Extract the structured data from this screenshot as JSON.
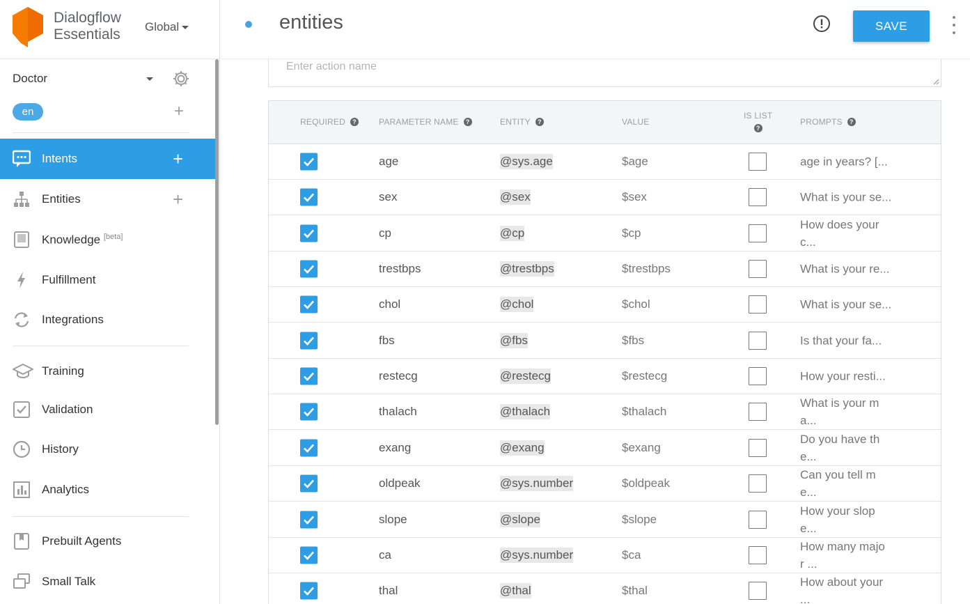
{
  "brand": {
    "line1": "Dialogflow",
    "line2": "Essentials",
    "region": "Global",
    "logo_color": "#f57c00"
  },
  "agent": {
    "name": "Doctor",
    "language": "en"
  },
  "nav": {
    "intents": "Intents",
    "entities": "Entities",
    "knowledge": "Knowledge",
    "knowledge_badge": "[beta]",
    "fulfillment": "Fulfillment",
    "integrations": "Integrations",
    "training": "Training",
    "validation": "Validation",
    "history": "History",
    "analytics": "Analytics",
    "prebuilt": "Prebuilt Agents",
    "smalltalk": "Small Talk"
  },
  "header": {
    "title": "entities",
    "save_label": "SAVE"
  },
  "action": {
    "placeholder": "Enter action name"
  },
  "table": {
    "columns": {
      "required": "REQUIRED",
      "parameter": "PARAMETER NAME",
      "entity": "ENTITY",
      "value": "VALUE",
      "islist": "IS LIST",
      "prompts": "PROMPTS"
    },
    "rows": [
      {
        "required": true,
        "name": "age",
        "entity": "@sys.age",
        "value": "$age",
        "is_list": false,
        "prompt": "age in years? [..."
      },
      {
        "required": true,
        "name": "sex",
        "entity": "@sex",
        "value": "$sex",
        "is_list": false,
        "prompt": "What is your se..."
      },
      {
        "required": true,
        "name": "cp",
        "entity": "@cp",
        "value": "$cp",
        "is_list": false,
        "prompt": "How does your\nc..."
      },
      {
        "required": true,
        "name": "trestbps",
        "entity": "@trestbps",
        "value": "$trestbps",
        "is_list": false,
        "prompt": "What is your re..."
      },
      {
        "required": true,
        "name": "chol",
        "entity": "@chol",
        "value": "$chol",
        "is_list": false,
        "prompt": "What is your se..."
      },
      {
        "required": true,
        "name": "fbs",
        "entity": "@fbs",
        "value": "$fbs",
        "is_list": false,
        "prompt": "Is that your fa..."
      },
      {
        "required": true,
        "name": "restecg",
        "entity": "@restecg",
        "value": "$restecg",
        "is_list": false,
        "prompt": "How your resti..."
      },
      {
        "required": true,
        "name": "thalach",
        "entity": "@thalach",
        "value": "$thalach",
        "is_list": false,
        "prompt": "What is your m\na..."
      },
      {
        "required": true,
        "name": "exang",
        "entity": "@exang",
        "value": "$exang",
        "is_list": false,
        "prompt": "Do you have th\ne..."
      },
      {
        "required": true,
        "name": "oldpeak",
        "entity": "@sys.number",
        "value": "$oldpeak",
        "is_list": false,
        "prompt": "Can you tell m\ne..."
      },
      {
        "required": true,
        "name": "slope",
        "entity": "@slope",
        "value": "$slope",
        "is_list": false,
        "prompt": "How your slop\ne..."
      },
      {
        "required": true,
        "name": "ca",
        "entity": "@sys.number",
        "value": "$ca",
        "is_list": false,
        "prompt": "How many majo\nr ..."
      },
      {
        "required": true,
        "name": "thal",
        "entity": "@thal",
        "value": "$thal",
        "is_list": false,
        "prompt": "How about your\n..."
      }
    ]
  }
}
